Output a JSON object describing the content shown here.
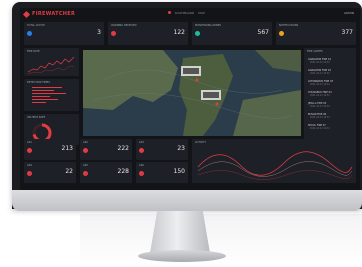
{
  "app": {
    "name": "FIREWATCHER"
  },
  "nav": {
    "item1": "DASHBOARD",
    "item2": "MAP"
  },
  "user": "ADMIN",
  "stats": [
    {
      "label": "TOTAL ACTIVE",
      "value": "3",
      "color": "#2b7de9"
    },
    {
      "label": "WARNING RECEIVED",
      "value": "122",
      "color": "#e23b45"
    },
    {
      "label": "MONITORING ZONES",
      "value": "567",
      "color": "#18c0a0"
    },
    {
      "label": "NOTIFICATIONS",
      "value": "377",
      "color": "#f0a020"
    }
  ],
  "panels": {
    "trend": "FIRE RATE",
    "bars": "DETECTION TIMES",
    "donut": "ON HEAT RATE",
    "wave": "ACTIVITY",
    "sidebar": "FIRE ALERTS"
  },
  "sidebar_items": [
    {
      "title": "GANGWON FIRE 01",
      "sub": "2021-02-12 14:32"
    },
    {
      "title": "GANGWON FIRE 02",
      "sub": "2021-02-12 14:32"
    },
    {
      "title": "GYEONGBUK FIRE 03",
      "sub": "2021-02-12 14:32"
    },
    {
      "title": "CHUNGBUK FIRE 04",
      "sub": "2021-02-12 14:32"
    },
    {
      "title": "JEOLLA FIRE 05",
      "sub": "2021-02-12 14:32"
    },
    {
      "title": "BUSAN FIRE 06",
      "sub": "2021-02-12 14:32"
    },
    {
      "title": "SEOUL FIRE 07",
      "sub": "2021-02-12 14:32"
    }
  ],
  "bottom_stats": [
    {
      "label": "A01",
      "value": "213"
    },
    {
      "label": "A02",
      "value": "222"
    },
    {
      "label": "A03",
      "value": "23"
    },
    {
      "label": "A04",
      "value": "22"
    },
    {
      "label": "A05",
      "value": "228"
    },
    {
      "label": "A06",
      "value": "150"
    }
  ],
  "colors": {
    "accent": "#e23b45",
    "panel": "#1d2026",
    "screen": "#121418"
  }
}
